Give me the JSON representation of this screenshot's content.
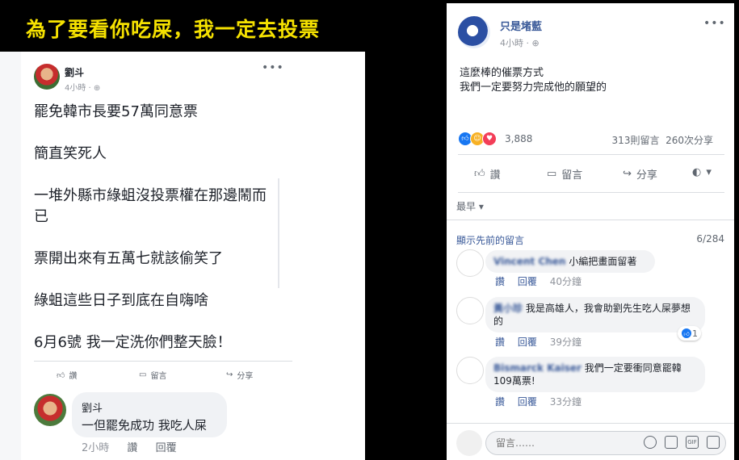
{
  "banner": {
    "text": "為了要看你吃屎，我一定去投票"
  },
  "left_post": {
    "author": "劉斗",
    "time": "4小時",
    "lines": [
      "罷免韓市長要57萬同意票",
      "簡直笑死人",
      "一堆外縣市綠蛆沒投票權在那邊鬧而已",
      "票開出來有五萬七就該偷笑了",
      "綠蛆這些日子到底在自嗨啥",
      "6月6號 我一定洗你們整天臉！"
    ],
    "actions": {
      "like": "讚",
      "comment": "留言",
      "share": "分享"
    },
    "comment": {
      "author": "劉斗",
      "text": "一但罷免成功 我吃人屎",
      "time": "2小時",
      "like": "讚",
      "reply": "回覆"
    }
  },
  "right_post": {
    "author": "只是堵藍",
    "time": "4小時",
    "lines": [
      "這麼棒的催票方式",
      "我們一定要努力完成他的願望的"
    ],
    "reaction_count": "3,888",
    "comment_count": "313則留言",
    "share_count": "260次分享",
    "actions": {
      "like": "讚",
      "comment": "留言",
      "share": "分享"
    },
    "sort_label": "最早",
    "view_previous": "顯示先前的留言",
    "pagination": "6/284",
    "comments": [
      {
        "author": "Vincent Chen",
        "text": "小編把畫面留著",
        "like": "讚",
        "reply": "回覆",
        "time": "40分鐘"
      },
      {
        "author": "黃小珍",
        "text": "我是高雄人，我會助劉先生吃人屎夢想的",
        "like": "讚",
        "reply": "回覆",
        "time": "39分鐘",
        "likes": "1"
      },
      {
        "author": "Bismarck Kaiser",
        "text": "我們一定要衝同意罷韓109萬票!",
        "like": "讚",
        "reply": "回覆",
        "time": "33分鐘"
      }
    ],
    "comment_placeholder": "留言……"
  },
  "colors": {
    "brand": "#385898",
    "banner_text": "#f5e100",
    "like_blue": "#1877f2"
  }
}
